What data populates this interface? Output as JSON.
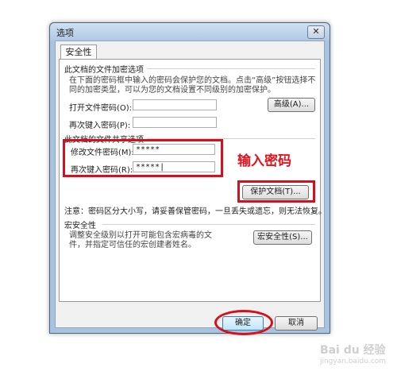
{
  "window": {
    "title": "选项"
  },
  "tab": {
    "label": "安全性"
  },
  "encrypt": {
    "heading": "此文档的文件加密选项",
    "desc_line1": "在下面的密码框中输入的密码会保护您的文档。点击“高级”按钮选择不",
    "desc_line2": "同的加密类型，可以为您的文档设置不同级别的加密保护。",
    "open_pw_label": "打开文件密码(O):",
    "open_pw_value": "",
    "reenter_label": "再次键入密码(P):",
    "reenter_value": "",
    "advanced_button": "高级(A)..."
  },
  "share": {
    "heading": "此文档的文件共享选项",
    "modify_pw_label": "修改文件密码(M):",
    "modify_pw_value": "*****",
    "reenter_label": "再次键入密码(R):",
    "reenter_value": "*****|",
    "protect_button": "保护文档(T)...",
    "annotation": "输入密码"
  },
  "note": "注意：密码区分大小写，请妥善保管密码，一旦丢失或遗忘，则无法恢复。",
  "macro": {
    "heading": "宏安全性",
    "desc_line1": "调整安全级别以打开可能包含宏病毒的文",
    "desc_line2": "件，并指定可信任的宏创建者姓名。",
    "button": "宏安全性(S)..."
  },
  "footer": {
    "ok": "确定",
    "cancel": "取消"
  },
  "watermark": {
    "brand": "Bai du 经验",
    "url": "jingyan.baidu.com"
  },
  "colors": {
    "annotation_red": "#d4101f",
    "default_button": "#3c7fb1"
  }
}
